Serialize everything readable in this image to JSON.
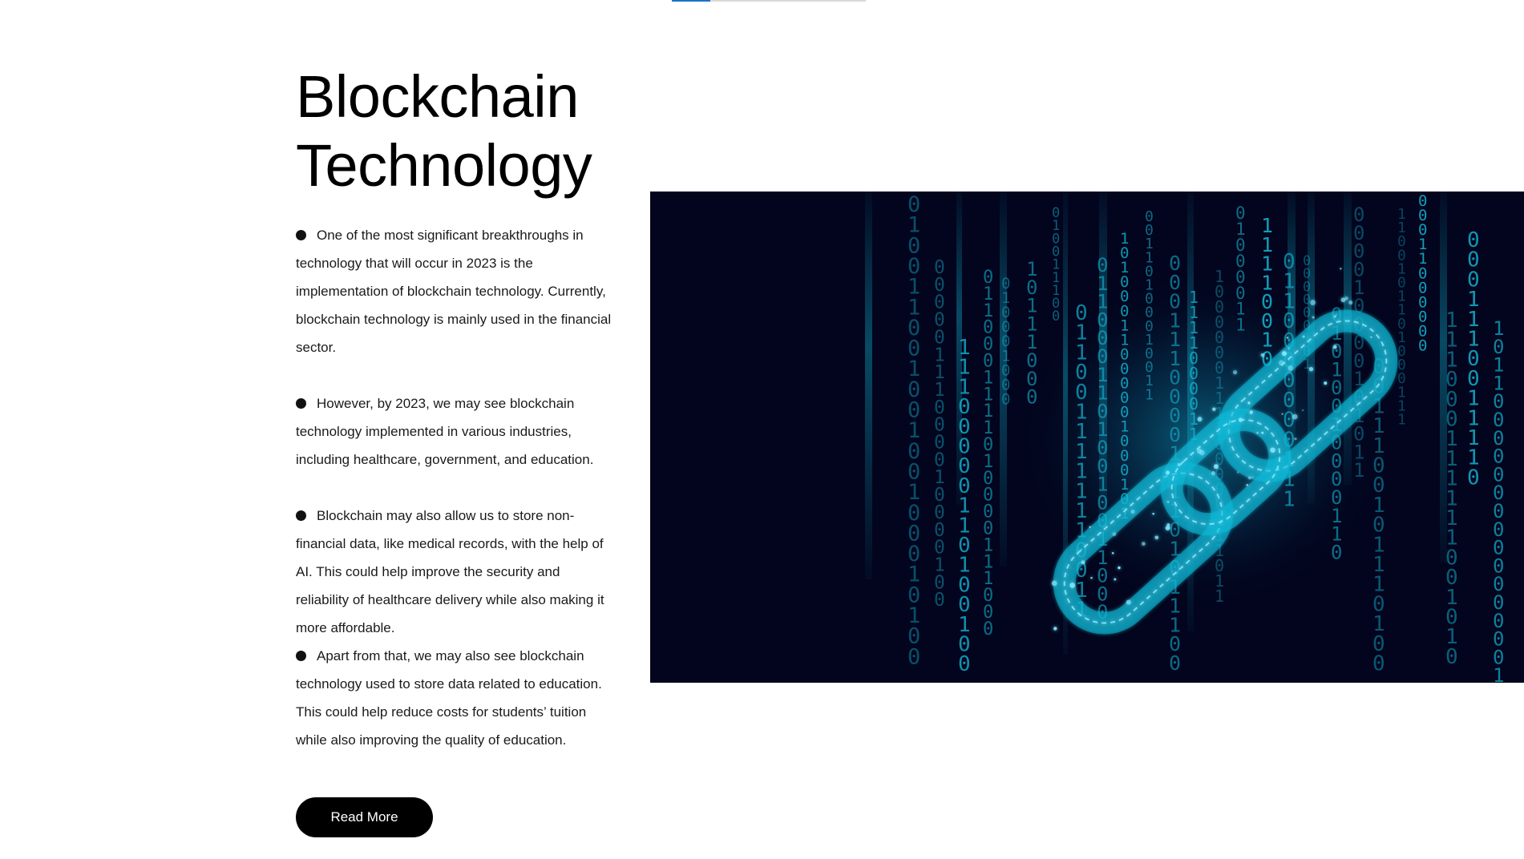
{
  "progress": {
    "fraction": 0.2
  },
  "section": {
    "title": "Blockchain Technology",
    "bullets": [
      "One of the most significant breakthroughs in technology that will occur in 2023 is the implementation of blockchain technology. Currently, blockchain technology is mainly used in the financial sector.",
      "However, by 2023, we may see blockchain technology implemented in various industries, including healthcare, government, and education.",
      "Blockchain may also allow us to store non-financial data, like medical records, with the help of AI. This could help improve the security and reliability of healthcare delivery while also making it more affordable.",
      "Apart from that, we may also see blockchain technology used to store data related to education. This could help reduce costs for students’ tuition while also improving the quality of education."
    ],
    "read_more_label": "Read More"
  },
  "hero": {
    "icon": "chain-link-icon",
    "colors": {
      "background": "#02051d",
      "accent": "#13b8d6",
      "glow": "#7de8ff"
    }
  }
}
